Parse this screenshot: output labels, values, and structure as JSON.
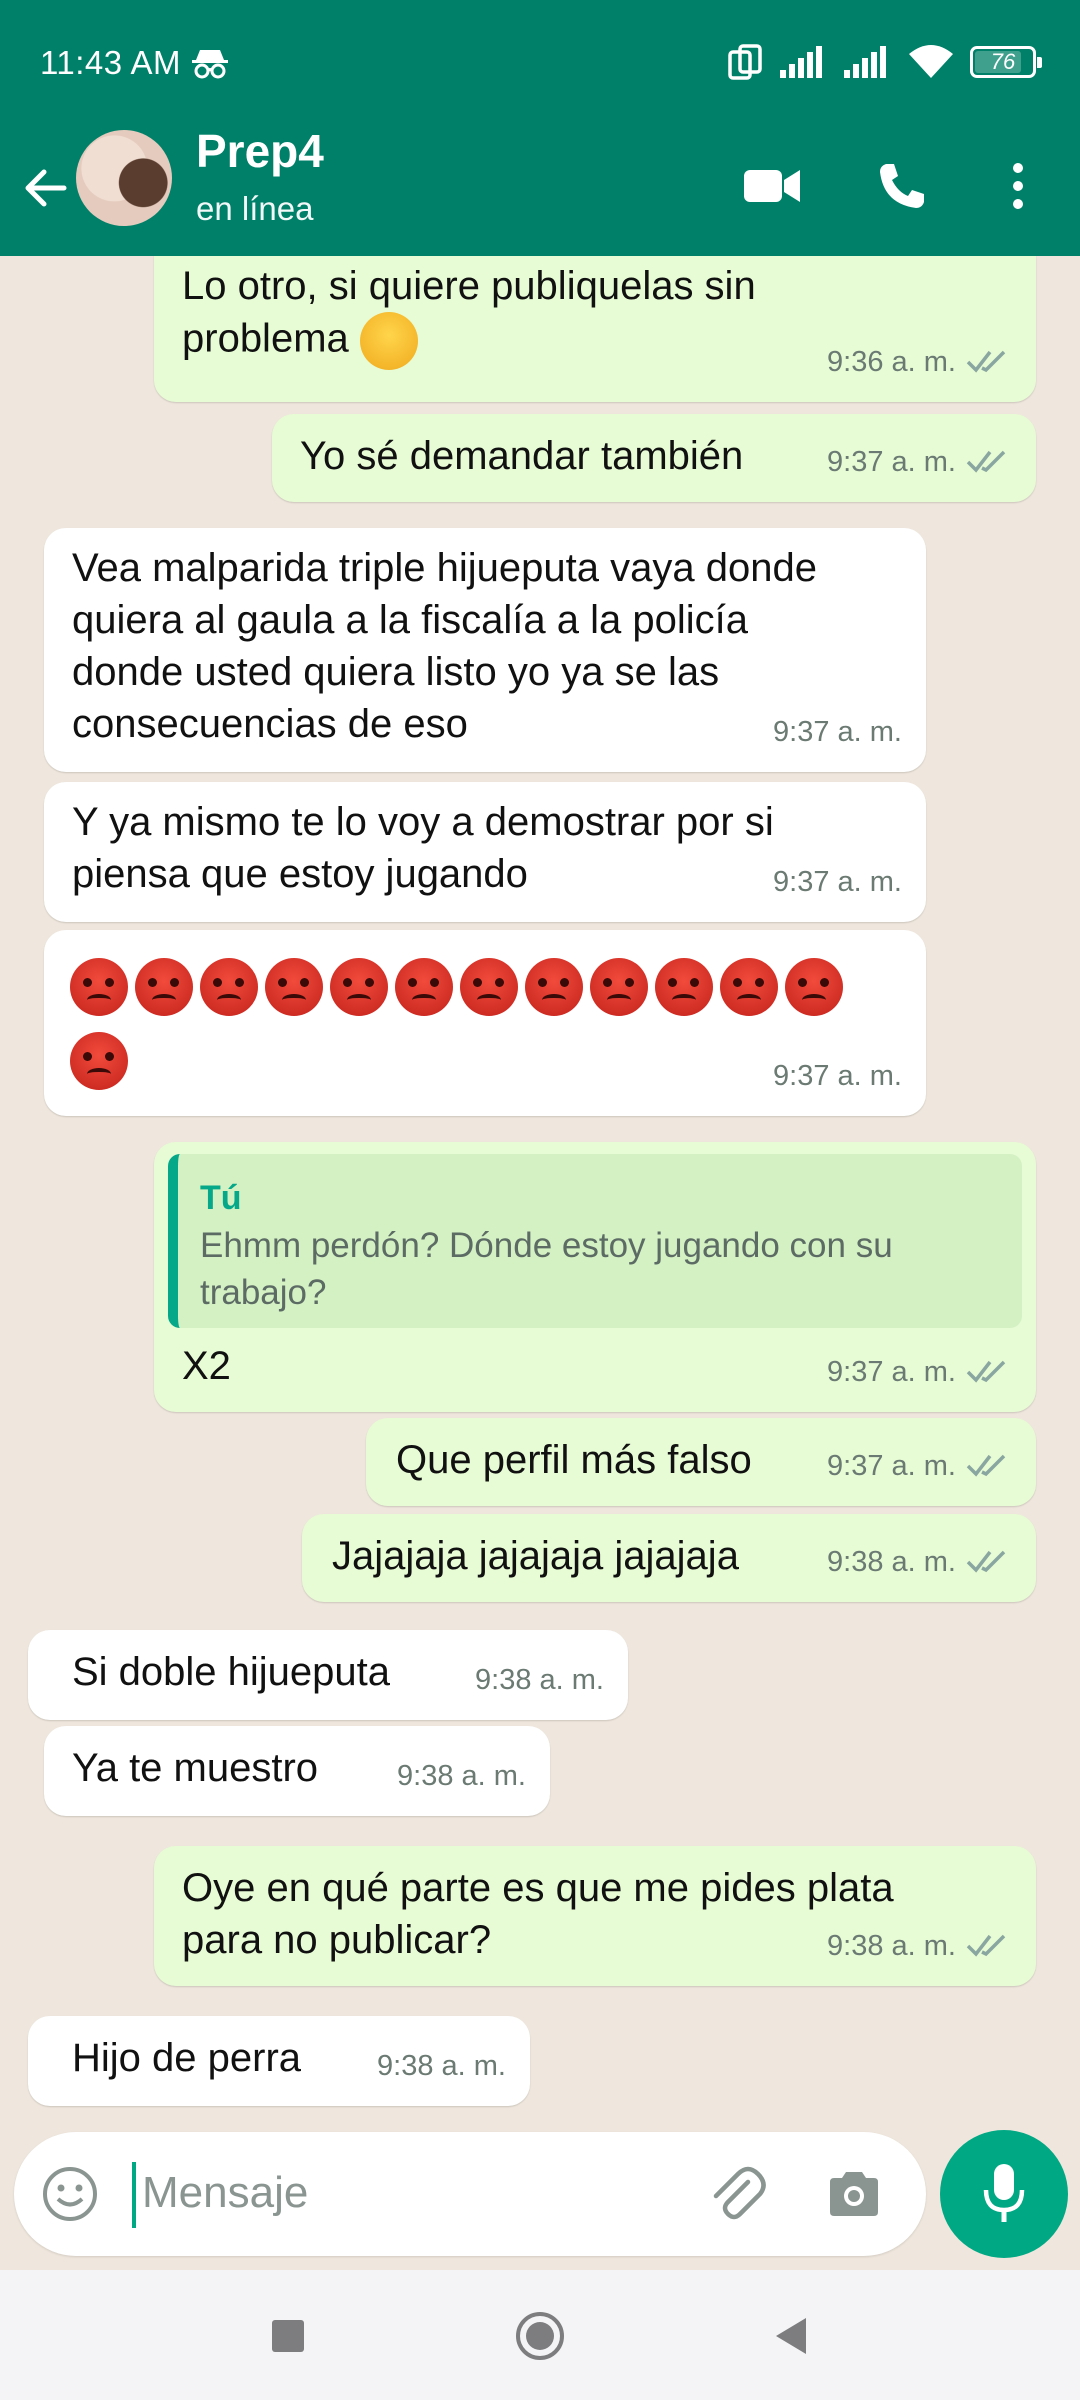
{
  "status_bar": {
    "time": "11:43 AM",
    "battery": "76"
  },
  "header": {
    "title": "Prep4",
    "subtitle": "en línea"
  },
  "messages": [
    {
      "dir": "out",
      "lines": [
        "Lo otro, si quiere publiquelas sin",
        "problema"
      ],
      "time": "9:36 a. m.",
      "ticks": true,
      "emoji": "smirk"
    },
    {
      "dir": "out",
      "lines": [
        "Yo sé demandar también"
      ],
      "time": "9:37 a. m.",
      "ticks": true
    },
    {
      "dir": "in",
      "lines": [
        "Vea malparida triple hijueputa vaya donde",
        "quiera al gaula a la fiscalía a la policía",
        "donde usted quiera listo yo ya se las",
        "consecuencias de eso"
      ],
      "time": "9:37 a. m."
    },
    {
      "dir": "in",
      "lines": [
        "Y ya mismo te lo voy a demostrar por si",
        "piensa que estoy jugando"
      ],
      "time": "9:37 a. m."
    },
    {
      "dir": "in",
      "emoji_count": 13,
      "time": "9:37 a. m."
    },
    {
      "dir": "out",
      "quote": {
        "name": "Tú",
        "text": [
          "Ehmm perdón? Dónde estoy jugando con su",
          "trabajo?"
        ]
      },
      "lines": [
        "X2"
      ],
      "time": "9:37 a. m.",
      "ticks": true
    },
    {
      "dir": "out",
      "lines": [
        "Que perfil más falso"
      ],
      "time": "9:37 a. m.",
      "ticks": true
    },
    {
      "dir": "out",
      "lines": [
        "Jajajaja jajajaja jajajaja"
      ],
      "time": "9:38 a. m.",
      "ticks": true
    },
    {
      "dir": "in",
      "lines": [
        "Si doble hijueputa"
      ],
      "time": "9:38 a. m."
    },
    {
      "dir": "in",
      "lines": [
        "Ya te muestro"
      ],
      "time": "9:38 a. m."
    },
    {
      "dir": "out",
      "lines": [
        "Oye en qué parte es que me pides plata",
        "para no publicar?"
      ],
      "time": "9:38 a. m.",
      "ticks": true
    },
    {
      "dir": "in",
      "lines": [
        "Hijo de perra"
      ],
      "time": "9:38 a. m."
    }
  ],
  "composer": {
    "placeholder": "Mensaje"
  },
  "colors": {
    "header": "#008069",
    "outgoing": "#e7fcd5",
    "incoming": "#ffffff",
    "accent": "#00a884",
    "read_ticks": "#8aa6a0"
  },
  "icons": [
    "back-arrow-icon",
    "video-call-icon",
    "phone-icon",
    "more-vert-icon",
    "emoji-icon",
    "attach-icon",
    "camera-icon",
    "mic-icon"
  ]
}
